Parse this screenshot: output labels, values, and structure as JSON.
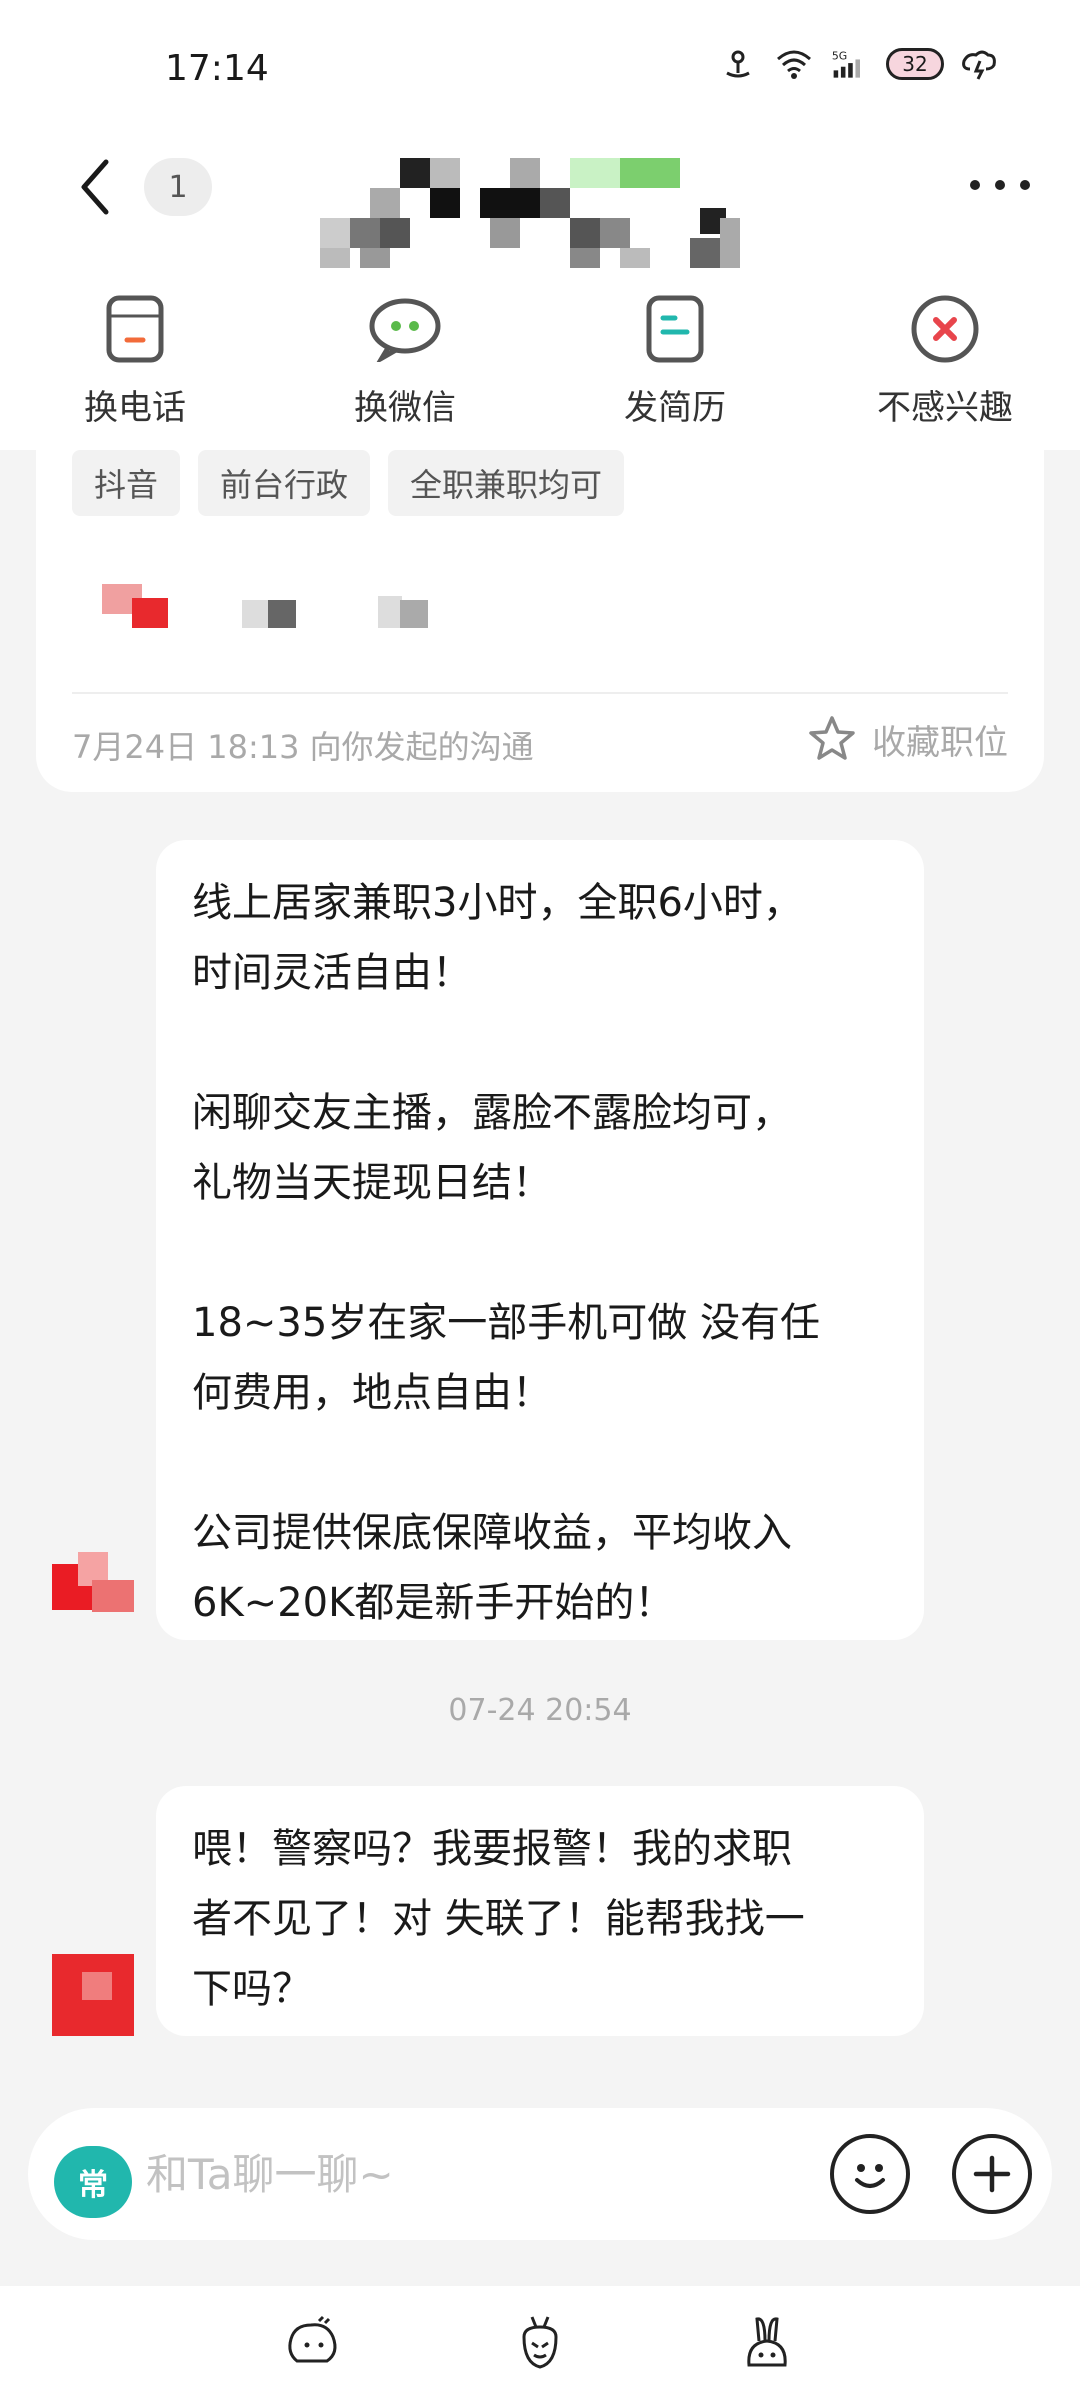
{
  "status": {
    "time": "17:14",
    "signal": "5G",
    "battery": "32"
  },
  "header": {
    "unread_count": "1"
  },
  "actions": [
    {
      "label": "换电话",
      "icon": "phone-swap-icon"
    },
    {
      "label": "换微信",
      "icon": "wechat-icon"
    },
    {
      "label": "发简历",
      "icon": "resume-icon"
    },
    {
      "label": "不感兴趣",
      "icon": "close-circle-icon"
    }
  ],
  "job_card": {
    "tags": [
      "抖音",
      "前台行政",
      "全职兼职均可"
    ],
    "footer_text": "7月24日 18:13 向你发起的沟通",
    "favorite_label": "收藏职位"
  },
  "messages": [
    {
      "text": "线上居家兼职3小时，全职6小时，\n时间灵活自由！\n\n闲聊交友主播，露脸不露脸均可，\n礼物当天提现日结！\n\n18~35岁在家一部手机可做 没有任\n何费用，地点自由！\n\n公司提供保底保障收益，平均收入\n6K~20K都是新手开始的！"
    },
    {
      "timestamp": "07-24 20:54"
    },
    {
      "text": "喂！警察吗？我要报警！我的求职\n者不见了！对 失联了！能帮我找一\n下吗？"
    }
  ],
  "input": {
    "placeholder": "和Ta聊一聊~",
    "keyboard_badge": "常"
  },
  "colors": {
    "accent": "#21b7ad",
    "danger": "#e8454c",
    "wechat": "#5aba4a"
  }
}
